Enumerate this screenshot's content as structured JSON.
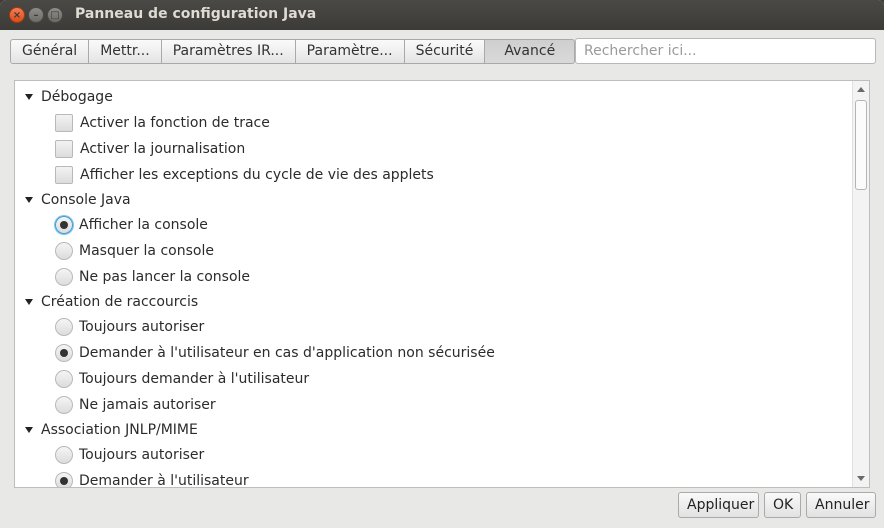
{
  "window": {
    "title": "Panneau de configuration Java",
    "close_glyph": "×",
    "min_glyph": "–",
    "max_glyph": "□"
  },
  "tabs": [
    {
      "label": "Général",
      "active": false
    },
    {
      "label": "Mettr...",
      "active": false
    },
    {
      "label": "Paramètres IR...",
      "active": false
    },
    {
      "label": "Paramètre...",
      "active": false
    },
    {
      "label": "Sécurité",
      "active": false
    },
    {
      "label": "Avancé",
      "active": true
    }
  ],
  "search": {
    "placeholder": "Rechercher ici..."
  },
  "tree": {
    "debug": {
      "label": "Débogage",
      "items": [
        "Activer la fonction de trace",
        "Activer la journalisation",
        "Afficher les exceptions du cycle de vie des applets"
      ]
    },
    "console": {
      "label": "Console Java",
      "items": [
        "Afficher la console",
        "Masquer la console",
        "Ne pas lancer la console"
      ],
      "selected": 0
    },
    "shortcut": {
      "label": "Création de raccourcis",
      "items": [
        "Toujours autoriser",
        "Demander à l'utilisateur en cas d'application non sécurisée",
        "Toujours demander à l'utilisateur",
        "Ne jamais autoriser"
      ],
      "selected": 1
    },
    "jnlp": {
      "label": "Association JNLP/MIME",
      "items": [
        "Toujours autoriser",
        "Demander à l'utilisateur"
      ],
      "selected": 1
    }
  },
  "buttons": {
    "apply": "Appliquer",
    "ok": "OK",
    "cancel": "Annuler"
  }
}
